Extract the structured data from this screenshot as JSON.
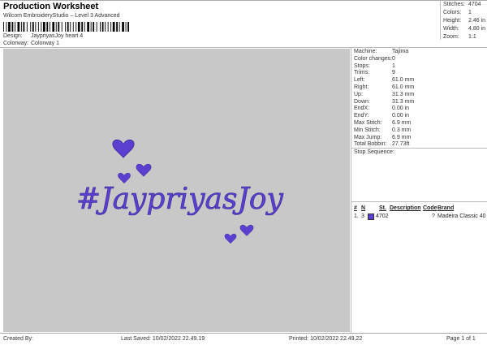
{
  "header": {
    "title": "Production Worksheet",
    "subtitle": "Wilcom EmbroideryStudio – Level 3 Advanced",
    "design_label": "Design:",
    "design_value": "JaypriyasJoy heart 4",
    "colorway_label": "Colorway:",
    "colorway_value": "Colorway 1"
  },
  "stats": [
    {
      "label": "Stitches:",
      "value": "4704"
    },
    {
      "label": "Colors:",
      "value": "1"
    },
    {
      "label": "Height:",
      "value": "2.46 in"
    },
    {
      "label": "Width:",
      "value": "4.80 in"
    },
    {
      "label": "Zoom:",
      "value": "1:1"
    }
  ],
  "design": {
    "text": "#JaypriyasJoy",
    "thread_color": "#5a3fd0",
    "background_color": "#c8c8c8"
  },
  "machine_info": [
    {
      "label": "Machine:",
      "value": "Tajima"
    },
    {
      "label": "Color changes:",
      "value": "0"
    },
    {
      "label": "Stops:",
      "value": "1"
    },
    {
      "label": "Trims:",
      "value": "9"
    },
    {
      "label": "Left:",
      "value": "61.0 mm"
    },
    {
      "label": "Right:",
      "value": "61.0 mm"
    },
    {
      "label": "Up:",
      "value": "31.3 mm"
    },
    {
      "label": "Down:",
      "value": "31.3 mm"
    },
    {
      "label": "EndX:",
      "value": "0.00 in"
    },
    {
      "label": "EndY:",
      "value": "0.00 in"
    },
    {
      "label": "Max Stitch:",
      "value": "6.9 mm"
    },
    {
      "label": "Min Stitch:",
      "value": "0.3 mm"
    },
    {
      "label": "Max Jump:",
      "value": "6.9 mm"
    },
    {
      "label": "Total Bobbin:",
      "value": "27.73ft"
    }
  ],
  "stop_sequence": {
    "title": "Stop Sequence:",
    "headers": [
      "#",
      "N",
      "St.",
      "Description",
      "Code",
      "Brand"
    ],
    "row": {
      "num": "1.",
      "n": "3",
      "stitches": "4702",
      "code": "?",
      "brand": "Madeira Classic 40"
    }
  },
  "footer": {
    "created_by": "Created By:",
    "last_saved": "Last Saved: 10/02/2022 22.49.19",
    "printed": "Printed: 10/02/2022 22.49.22",
    "page": "Page 1 of 1"
  }
}
